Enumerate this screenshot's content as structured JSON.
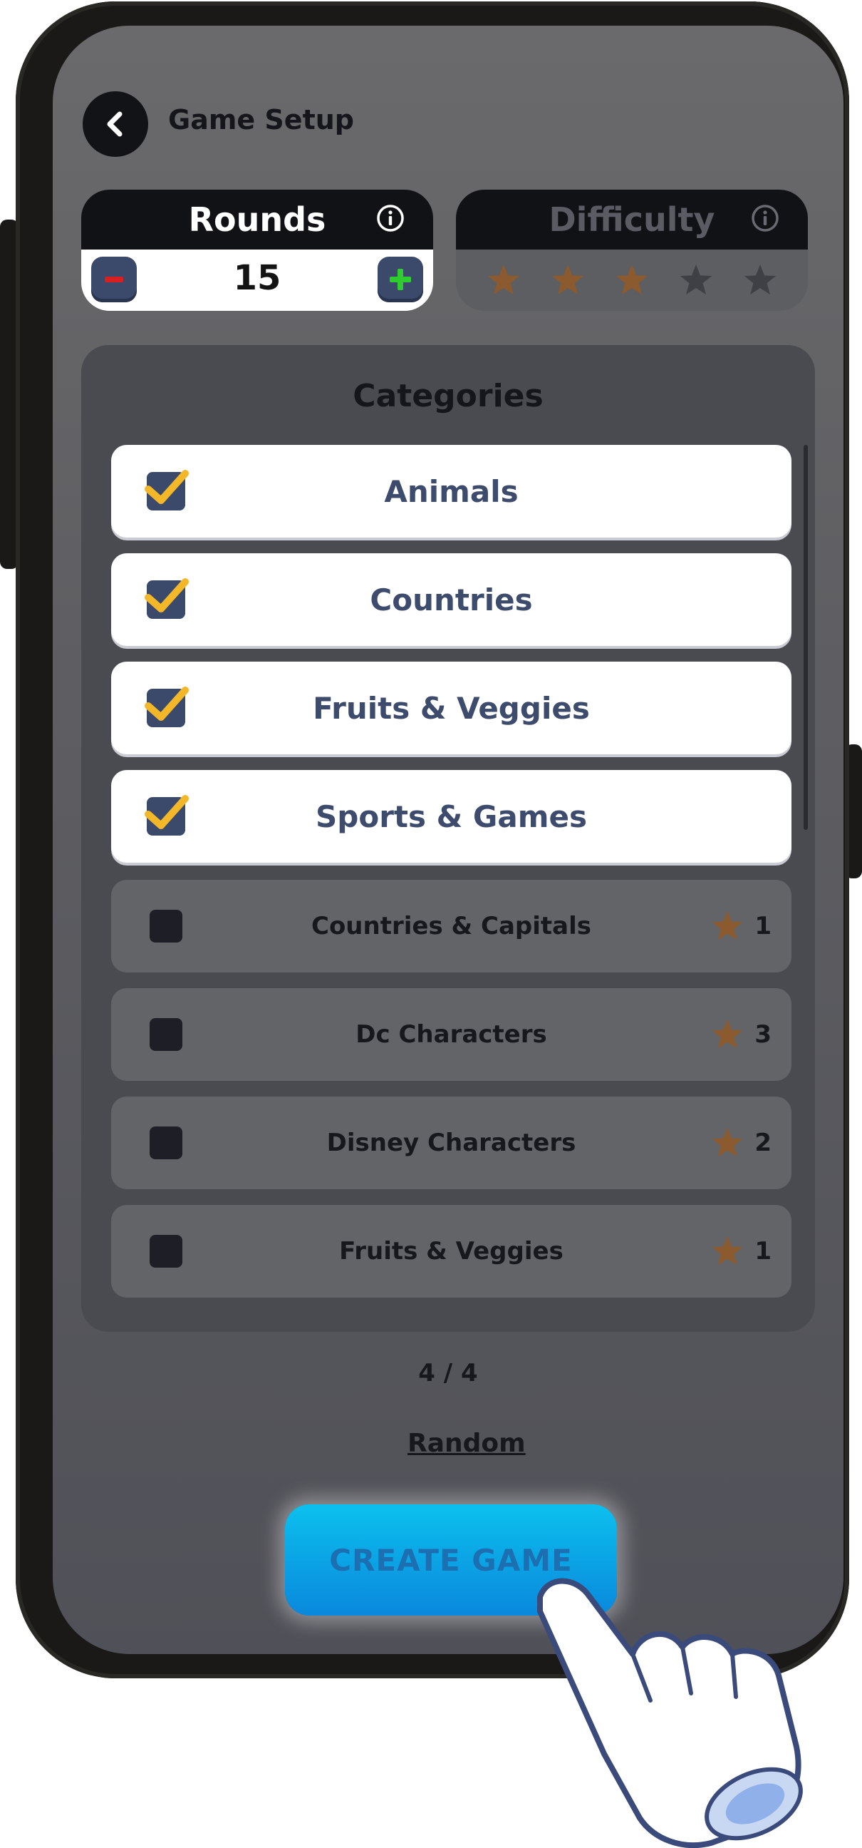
{
  "header": {
    "title": "Game Setup"
  },
  "rounds": {
    "label": "Rounds",
    "value": "15"
  },
  "difficulty": {
    "label": "Difficulty",
    "filled_stars": 3,
    "total_stars": 5
  },
  "categories": {
    "title": "Categories",
    "selected": [
      {
        "label": "Animals"
      },
      {
        "label": "Countries"
      },
      {
        "label": "Fruits & Veggies"
      },
      {
        "label": "Sports & Games"
      }
    ],
    "available": [
      {
        "label": "Countries & Capitals",
        "difficulty": "1"
      },
      {
        "label": "Dc Characters",
        "difficulty": "3"
      },
      {
        "label": "Disney Characters",
        "difficulty": "2"
      },
      {
        "label": "Fruits & Veggies",
        "difficulty": "1"
      }
    ]
  },
  "selection_count": "4 / 4",
  "random_label": "Random",
  "create_button": {
    "label": "CREATE GAME"
  },
  "colors": {
    "selected_row": "#ffffff",
    "checkbox_fill": "#3b4a6b",
    "checkmark": "#f2b829",
    "star_active": "#8b5a2e",
    "star_inactive": "#3f4045",
    "button_top": "#0cc0ee",
    "button_bottom": "#0a88dc"
  }
}
